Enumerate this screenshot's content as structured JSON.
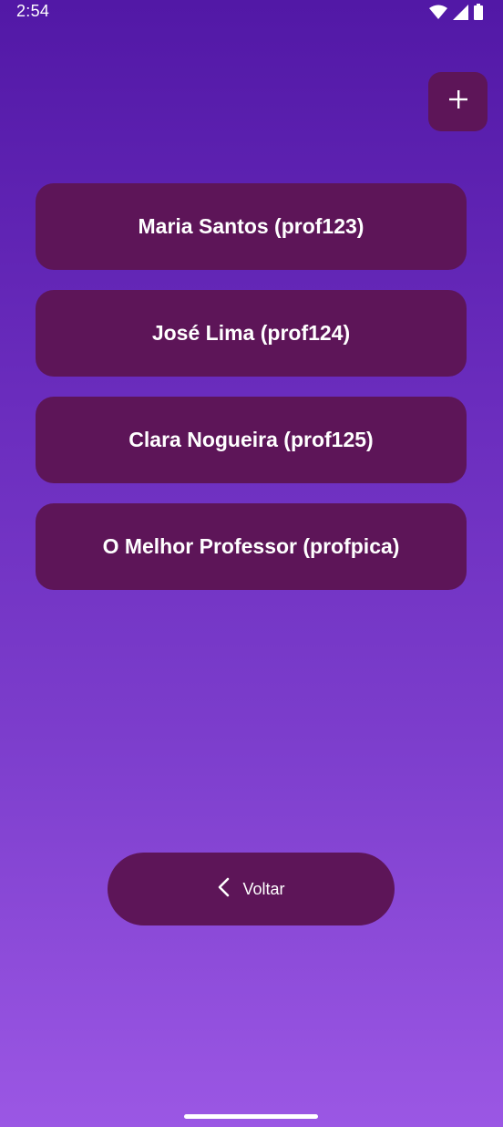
{
  "status_bar": {
    "time": "2:54"
  },
  "toolbar": {
    "add_icon": "plus-icon"
  },
  "professors": [
    {
      "label": "Maria Santos (prof123)"
    },
    {
      "label": "José Lima (prof124)"
    },
    {
      "label": "Clara Nogueira (prof125)"
    },
    {
      "label": "O Melhor Professor (profpica)"
    }
  ],
  "back_button": {
    "label": "Voltar",
    "icon": "chevron-left-icon"
  },
  "colors": {
    "button_bg": "#5d1558",
    "gradient_top": "#5218a6",
    "gradient_bottom": "#9b57e4"
  }
}
